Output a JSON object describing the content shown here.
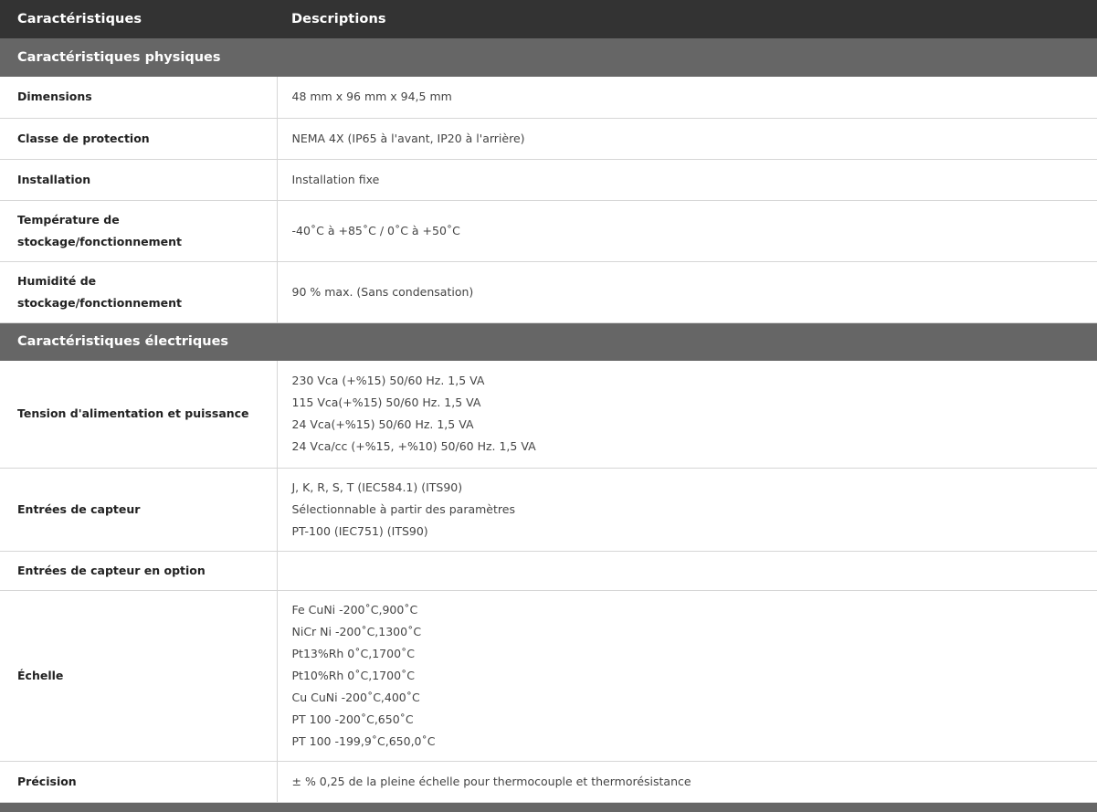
{
  "header": {
    "col1": "Caractéristiques",
    "col2": "Descriptions"
  },
  "sections": {
    "physical": {
      "title": "Caractéristiques physiques",
      "rows": [
        {
          "label": [
            "Dimensions"
          ],
          "value": [
            "48 mm x 96 mm x 94,5 mm"
          ]
        },
        {
          "label": [
            "Classe de protection"
          ],
          "value": [
            "NEMA 4X (IP65 à l'avant, IP20 à l'arrière)"
          ]
        },
        {
          "label": [
            "Installation"
          ],
          "value": [
            "Installation fixe"
          ]
        },
        {
          "label": [
            "Température de",
            "stockage/fonctionnement"
          ],
          "value": [
            "-40˚C à +85˚C / 0˚C à +50˚C"
          ]
        },
        {
          "label": [
            "Humidité de",
            "stockage/fonctionnement"
          ],
          "value": [
            "90 % max. (Sans condensation)"
          ]
        }
      ]
    },
    "electrical": {
      "title": "Caractéristiques électriques",
      "rows": [
        {
          "label": [
            "Tension d'alimentation et puissance"
          ],
          "value": [
            "230 Vca (+%15) 50/60 Hz. 1,5 VA",
            "115 Vca(+%15) 50/60 Hz. 1,5 VA",
            "24 Vca(+%15) 50/60 Hz. 1,5 VA",
            "24 Vca/cc (+%15, +%10) 50/60 Hz. 1,5 VA"
          ]
        },
        {
          "label": [
            "Entrées de capteur"
          ],
          "value": [
            "J, K, R, S, T (IEC584.1) (ITS90)",
            "Sélectionnable à partir des paramètres",
            "PT-100 (IEC751) (ITS90)"
          ]
        },
        {
          "label": [
            "Entrées de capteur en option"
          ],
          "value": []
        },
        {
          "label": [
            "Échelle"
          ],
          "value": [
            "Fe CuNi -200˚C,900˚C",
            "NiCr Ni -200˚C,1300˚C",
            "Pt13%Rh 0˚C,1700˚C",
            "Pt10%Rh 0˚C,1700˚C",
            "Cu CuNi -200˚C,400˚C",
            "PT 100 -200˚C,650˚C",
            "PT 100 -199,9˚C,650,0˚C"
          ]
        },
        {
          "label": [
            "Précision"
          ],
          "value": [
            "± % 0,25 de la pleine échelle pour thermocouple et thermorésistance"
          ]
        }
      ]
    }
  }
}
